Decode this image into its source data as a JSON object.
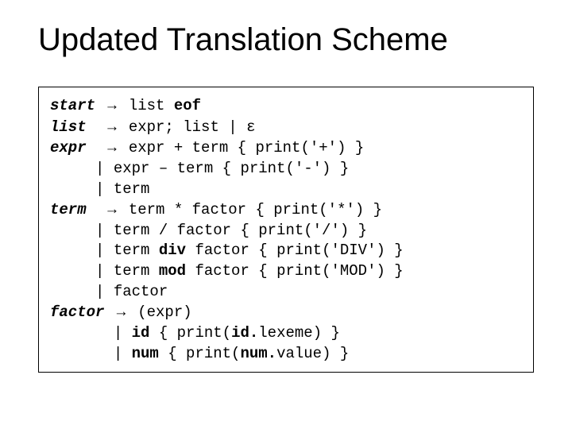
{
  "title": "Updated Translation Scheme",
  "g": {
    "r0": {
      "lhs": "start",
      "arr": "→",
      "a": " list ",
      "eof": "eof"
    },
    "r1": {
      "lhs": "list",
      "arr": "→",
      "a": " expr; list | ",
      "eps": "ε"
    },
    "r2": {
      "lhs": "expr",
      "arr": "→",
      "a": " expr + term { print('+') }"
    },
    "r3": {
      "a": "     | expr – term { print('-') }"
    },
    "r4": {
      "a": "     | term"
    },
    "r5": {
      "lhs": "term",
      "arr": "→",
      "a": " term * factor { print('*') }"
    },
    "r6": {
      "a": "     | term / factor { print('/') }"
    },
    "r7": {
      "a": "     | term ",
      "kw": "div",
      "b": " factor { print('DIV') }"
    },
    "r8": {
      "a": "     | term ",
      "kw": "mod",
      "b": " factor { print('MOD') }"
    },
    "r9": {
      "a": "     | factor"
    },
    "r10": {
      "lhs": "factor",
      "arr": "→",
      "a": " (expr)"
    },
    "r11": {
      "a": "       | ",
      "kw": "id",
      "b": " { print(",
      "kw2": "id.",
      "c": "lexeme) }"
    },
    "r12": {
      "a": "       | ",
      "kw": "num",
      "b": " { print(",
      "kw2": "num.",
      "c": "value) }"
    }
  }
}
